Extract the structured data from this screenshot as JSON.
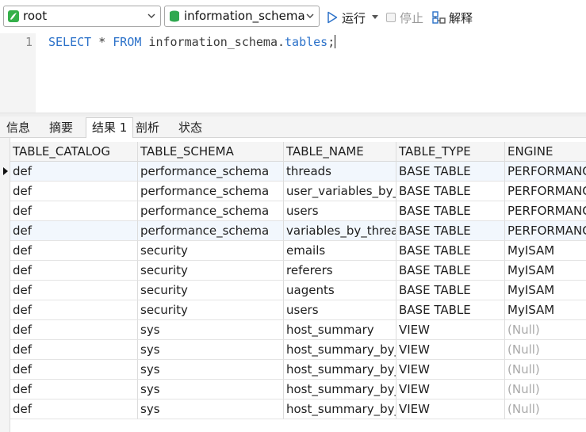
{
  "toolbar": {
    "connection": "root",
    "database": "information_schema",
    "run_label": "运行",
    "stop_label": "停止",
    "explain_label": "解释",
    "icons": {
      "connection": "connection-icon",
      "database": "database-icon",
      "run": "play-icon",
      "stop": "stop-icon",
      "explain": "explain-icon"
    }
  },
  "editor": {
    "line_number": "1",
    "kw_select": "SELECT",
    "star": " * ",
    "kw_from": "FROM",
    "schema": " information_schema.",
    "table": "tables",
    "semicolon": ";"
  },
  "tabs": [
    "信息",
    "摘要",
    "结果 1",
    "剖析",
    "状态"
  ],
  "active_tab": "结果 1",
  "grid": {
    "columns": [
      "TABLE_CATALOG",
      "TABLE_SCHEMA",
      "TABLE_NAME",
      "TABLE_TYPE",
      "ENGINE"
    ],
    "rows": [
      [
        "def",
        "performance_schema",
        "threads",
        "BASE TABLE",
        "PERFORMANCE"
      ],
      [
        "def",
        "performance_schema",
        "user_variables_by_thread",
        "BASE TABLE",
        "PERFORMANCE"
      ],
      [
        "def",
        "performance_schema",
        "users",
        "BASE TABLE",
        "PERFORMANCE"
      ],
      [
        "def",
        "performance_schema",
        "variables_by_thread",
        "BASE TABLE",
        "PERFORMANCE"
      ],
      [
        "def",
        "security",
        "emails",
        "BASE TABLE",
        "MyISAM"
      ],
      [
        "def",
        "security",
        "referers",
        "BASE TABLE",
        "MyISAM"
      ],
      [
        "def",
        "security",
        "uagents",
        "BASE TABLE",
        "MyISAM"
      ],
      [
        "def",
        "security",
        "users",
        "BASE TABLE",
        "MyISAM"
      ],
      [
        "def",
        "sys",
        "host_summary",
        "VIEW",
        "(Null)"
      ],
      [
        "def",
        "sys",
        "host_summary_by_file_io",
        "VIEW",
        "(Null)"
      ],
      [
        "def",
        "sys",
        "host_summary_by_file_io_type",
        "VIEW",
        "(Null)"
      ],
      [
        "def",
        "sys",
        "host_summary_by_stages",
        "VIEW",
        "(Null)"
      ],
      [
        "def",
        "sys",
        "host_summary_by_statement_latency",
        "VIEW",
        "(Null)"
      ]
    ],
    "highlighted_rows": [
      0,
      3
    ]
  },
  "colors": {
    "keyword": "#2b71c9",
    "null_text": "#a9a9a9",
    "selected_row": "#f2f7fd",
    "db_icon": "#2fa84f",
    "conn_icon": "#35b04a"
  }
}
